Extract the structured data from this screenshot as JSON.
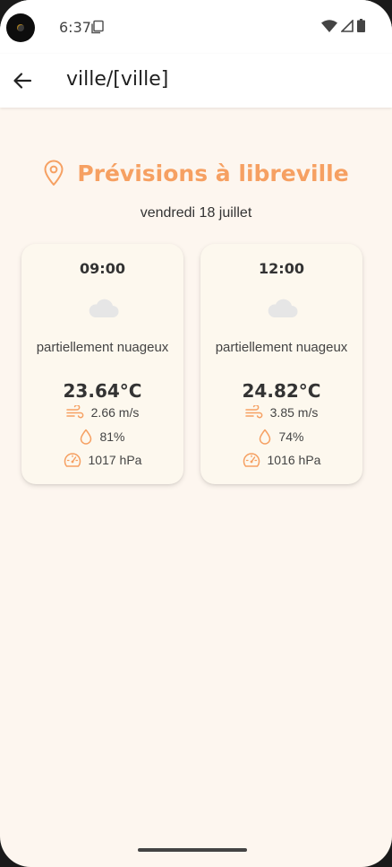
{
  "status_bar": {
    "time": "6:37"
  },
  "app_bar": {
    "title": "ville/[ville]"
  },
  "header": {
    "title": "Prévisions à libreville",
    "date": "vendredi 18 juillet"
  },
  "forecast": [
    {
      "time": "09:00",
      "description": "partiellement nuageux",
      "temperature": "23.64°C",
      "wind": "2.66 m/s",
      "humidity": "81%",
      "pressure": "1017 hPa"
    },
    {
      "time": "12:00",
      "description": "partiellement nuageux",
      "temperature": "24.82°C",
      "wind": "3.85 m/s",
      "humidity": "74%",
      "pressure": "1016 hPa"
    }
  ],
  "icons": {
    "location": "map-pin-icon",
    "weather": "cloud-icon",
    "wind": "wind-icon",
    "humidity": "droplet-icon",
    "pressure": "gauge-icon"
  },
  "colors": {
    "accent": "#f6a062",
    "background": "#fdf6ef",
    "card": "#fdf8ee",
    "cloud": "#e6e6e6"
  }
}
